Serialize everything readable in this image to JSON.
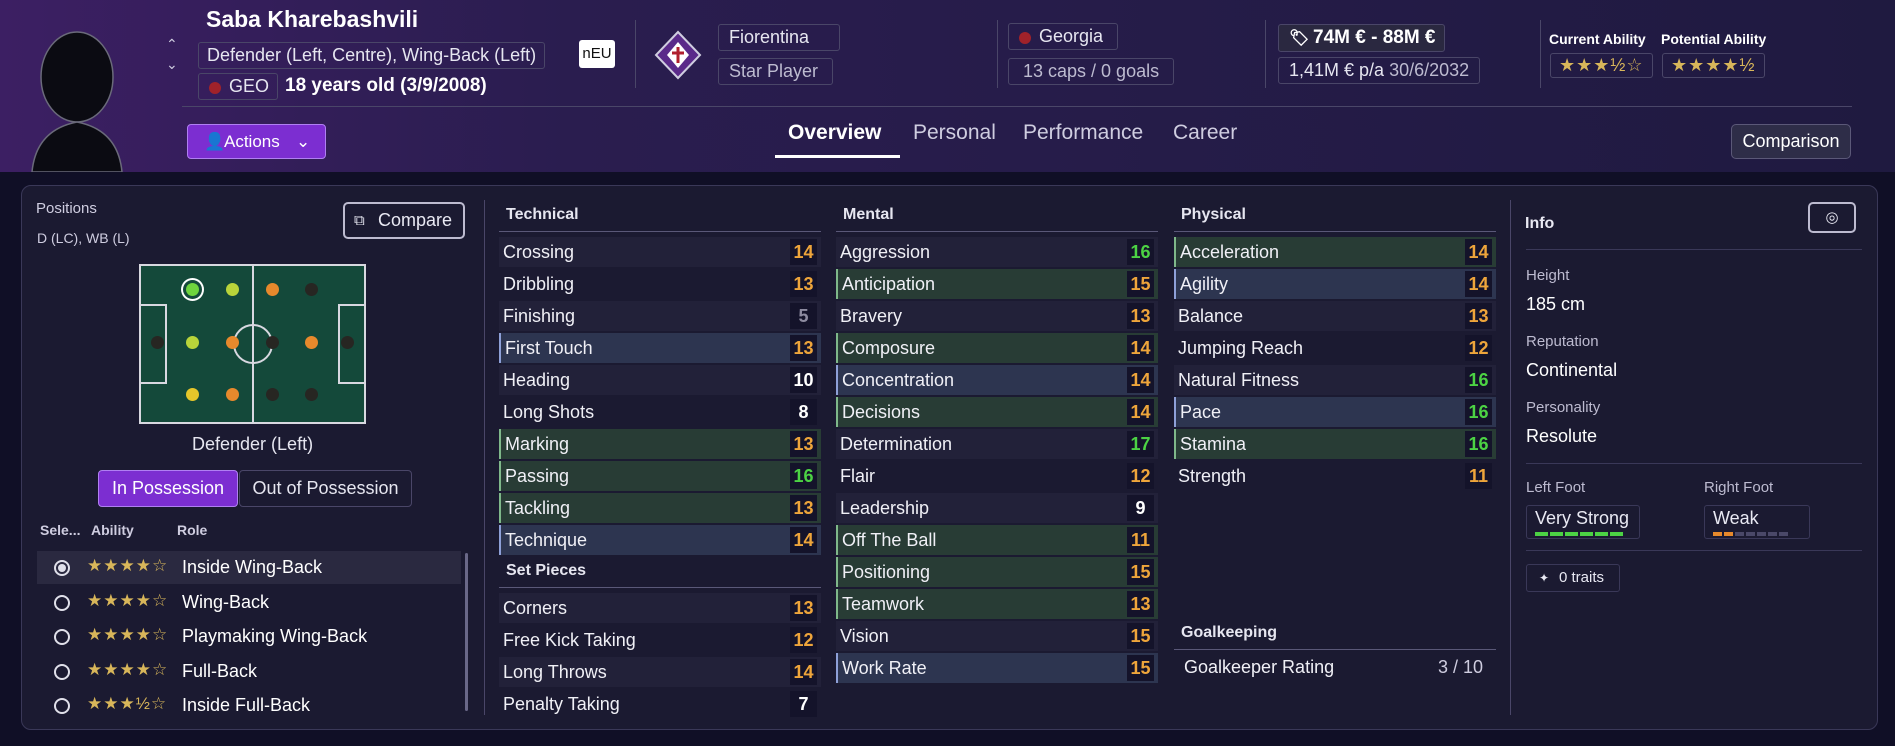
{
  "player": {
    "name": "Saba Kharebashvili",
    "positions": "Defender (Left, Centre), Wing-Back (Left)",
    "nation_code": "GEO",
    "age": "18 years old (3/9/2008)",
    "neu": "nEU"
  },
  "club": {
    "name": "Fiorentina",
    "status": "Star Player"
  },
  "country": {
    "name": "Georgia",
    "caps": "13 caps / 0 goals"
  },
  "value": {
    "range": "74M € - 88M €",
    "wage": "1,41M € p/a",
    "expiry": "30/6/2032"
  },
  "ability": {
    "current_label": "Current Ability",
    "potential_label": "Potential Ability",
    "current_stars": 3.5,
    "potential_stars": 4.5,
    "current": "★★★½☆",
    "potential": "★★★★½"
  },
  "actions_label": "Actions",
  "tabs": [
    "Overview",
    "Personal",
    "Performance",
    "Career"
  ],
  "comparison_label": "Comparison",
  "positions": {
    "title": "Positions",
    "value": "D (LC), WB (L)",
    "compare_label": "Compare",
    "selected_pos": "Defender (Left)",
    "in_possession": "In Possession",
    "out_possession": "Out of Possession",
    "headers": [
      "Sele...",
      "Ability",
      "Role"
    ],
    "roles": [
      {
        "stars": "★★★★☆",
        "name": "Inside Wing-Back",
        "selected": true
      },
      {
        "stars": "★★★★☆",
        "name": "Wing-Back",
        "selected": false
      },
      {
        "stars": "★★★★☆",
        "name": "Playmaking Wing-Back",
        "selected": false
      },
      {
        "stars": "★★★★☆",
        "name": "Full-Back",
        "selected": false
      },
      {
        "stars": "★★★½☆",
        "name": "Inside Full-Back",
        "selected": false
      }
    ]
  },
  "technical": {
    "title": "Technical",
    "attrs": [
      [
        "Crossing",
        "14"
      ],
      [
        "Dribbling",
        "13"
      ],
      [
        "Finishing",
        "5"
      ],
      [
        "First Touch",
        "13"
      ],
      [
        "Heading",
        "10"
      ],
      [
        "Long Shots",
        "8"
      ],
      [
        "Marking",
        "13"
      ],
      [
        "Passing",
        "16"
      ],
      [
        "Tackling",
        "13"
      ],
      [
        "Technique",
        "14"
      ]
    ]
  },
  "set_pieces": {
    "title": "Set Pieces",
    "attrs": [
      [
        "Corners",
        "13"
      ],
      [
        "Free Kick Taking",
        "12"
      ],
      [
        "Long Throws",
        "14"
      ],
      [
        "Penalty Taking",
        "7"
      ]
    ]
  },
  "mental": {
    "title": "Mental",
    "attrs": [
      [
        "Aggression",
        "16"
      ],
      [
        "Anticipation",
        "15"
      ],
      [
        "Bravery",
        "13"
      ],
      [
        "Composure",
        "14"
      ],
      [
        "Concentration",
        "14"
      ],
      [
        "Decisions",
        "14"
      ],
      [
        "Determination",
        "17"
      ],
      [
        "Flair",
        "12"
      ],
      [
        "Leadership",
        "9"
      ],
      [
        "Off The Ball",
        "11"
      ],
      [
        "Positioning",
        "15"
      ],
      [
        "Teamwork",
        "13"
      ],
      [
        "Vision",
        "15"
      ],
      [
        "Work Rate",
        "15"
      ]
    ]
  },
  "physical": {
    "title": "Physical",
    "attrs": [
      [
        "Acceleration",
        "14"
      ],
      [
        "Agility",
        "14"
      ],
      [
        "Balance",
        "13"
      ],
      [
        "Jumping Reach",
        "12"
      ],
      [
        "Natural Fitness",
        "16"
      ],
      [
        "Pace",
        "16"
      ],
      [
        "Stamina",
        "16"
      ],
      [
        "Strength",
        "11"
      ]
    ]
  },
  "goalkeeping": {
    "title": "Goalkeeping",
    "rating_label": "Goalkeeper Rating",
    "rating": "3 / 10"
  },
  "info": {
    "title": "Info",
    "height_label": "Height",
    "height": "185 cm",
    "reputation_label": "Reputation",
    "reputation": "Continental",
    "personality_label": "Personality",
    "personality": "Resolute",
    "left_foot_label": "Left Foot",
    "left_foot": "Very Strong",
    "right_foot_label": "Right Foot",
    "right_foot": "Weak",
    "traits": "0 traits"
  }
}
